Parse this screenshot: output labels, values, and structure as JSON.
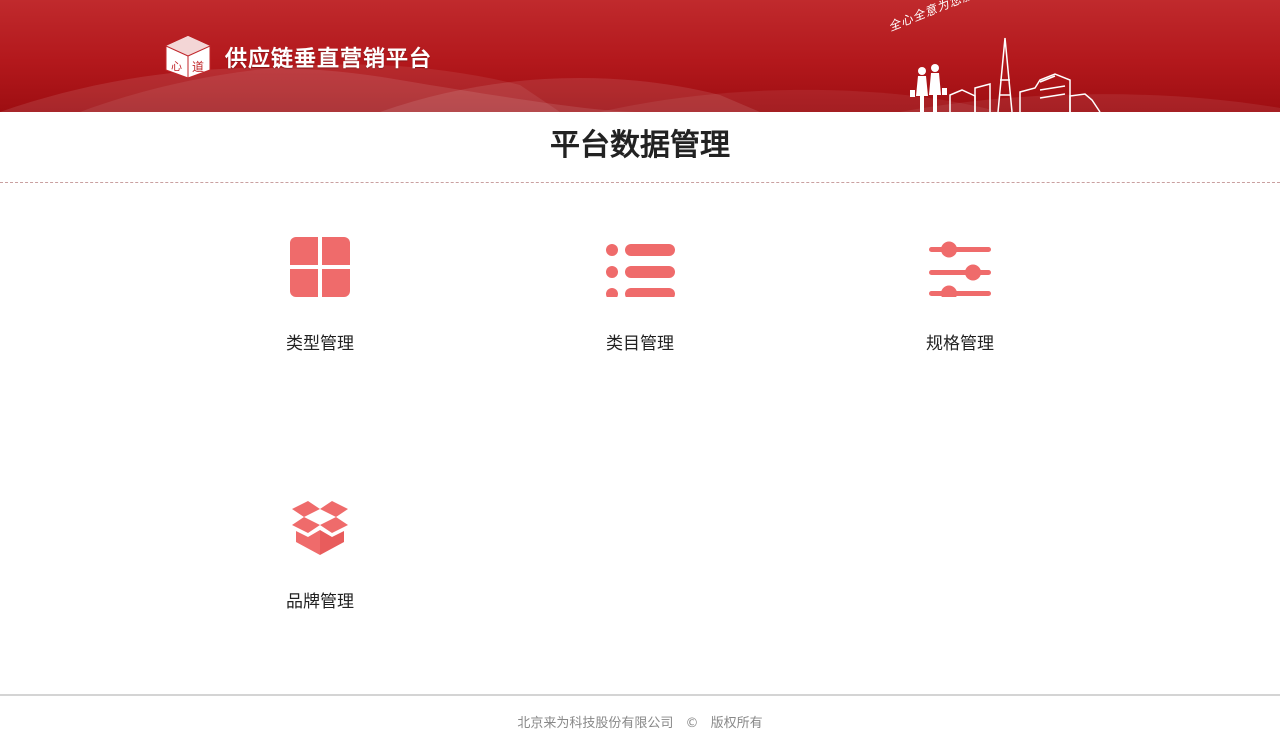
{
  "header": {
    "brand_name": "供应链垂直营销平台",
    "slogan": "全心全意为您服务!",
    "colors": {
      "banner": "#b3181c",
      "banner_dark": "#9e0e12"
    }
  },
  "page": {
    "title": "平台数据管理"
  },
  "tiles": [
    {
      "label": "类型管理",
      "icon": "grid-icon"
    },
    {
      "label": "类目管理",
      "icon": "list-icon"
    },
    {
      "label": "规格管理",
      "icon": "sliders-icon"
    },
    {
      "label": "品牌管理",
      "icon": "box-icon"
    }
  ],
  "footer": {
    "company": "北京来为科技股份有限公司",
    "copyright_symbol": "©",
    "rights": "版权所有"
  },
  "theme": {
    "icon_color": "#ef6b6b",
    "text_color": "#222222"
  }
}
